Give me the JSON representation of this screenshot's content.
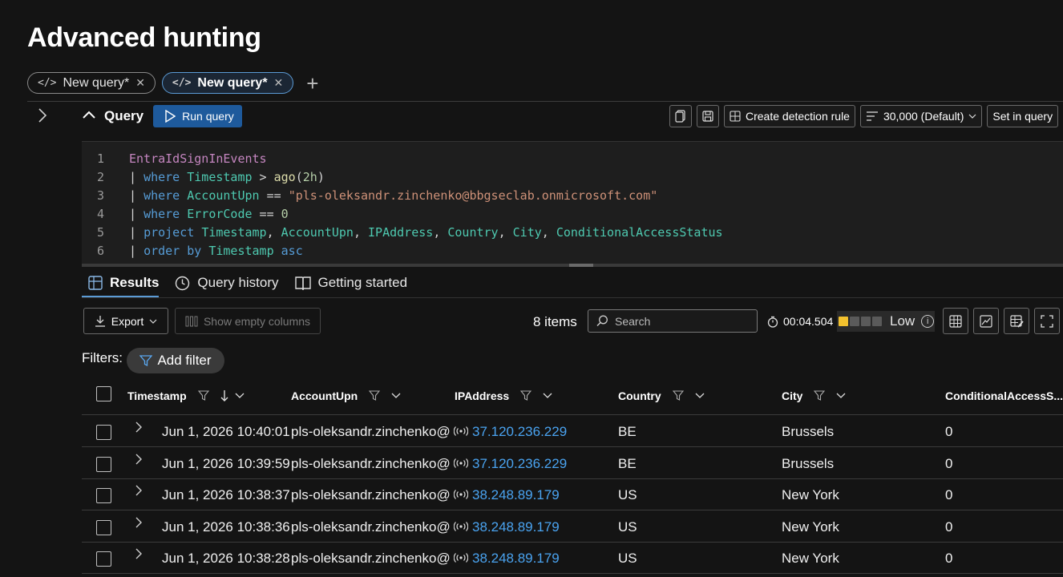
{
  "page": {
    "title": "Advanced hunting"
  },
  "tabs": [
    {
      "label": "New query*",
      "active": false
    },
    {
      "label": "New query*",
      "active": true
    }
  ],
  "query": {
    "header": "Query",
    "run_label": "Run query",
    "create_detection_label": "Create detection rule",
    "limit_label": "30,000 (Default)",
    "set_in_query_label": "Set in query",
    "lines": [
      {
        "n": "1",
        "tokens": [
          {
            "t": "EntraIdSignInEvents",
            "c": "tbl"
          }
        ]
      },
      {
        "n": "2",
        "tokens": [
          {
            "t": "| ",
            "c": "op"
          },
          {
            "t": "where",
            "c": "kw"
          },
          {
            "t": " ",
            "c": "op"
          },
          {
            "t": "Timestamp",
            "c": "col"
          },
          {
            "t": " > ",
            "c": "op"
          },
          {
            "t": "ago",
            "c": "fn"
          },
          {
            "t": "(",
            "c": "op"
          },
          {
            "t": "2h",
            "c": "num"
          },
          {
            "t": ")",
            "c": "op"
          }
        ]
      },
      {
        "n": "3",
        "tokens": [
          {
            "t": "| ",
            "c": "op"
          },
          {
            "t": "where",
            "c": "kw"
          },
          {
            "t": " ",
            "c": "op"
          },
          {
            "t": "AccountUpn",
            "c": "col"
          },
          {
            "t": " == ",
            "c": "op"
          },
          {
            "t": "\"pls-oleksandr.zinchenko@bbgseclab.onmicrosoft.com\"",
            "c": "str"
          }
        ]
      },
      {
        "n": "4",
        "tokens": [
          {
            "t": "| ",
            "c": "op"
          },
          {
            "t": "where",
            "c": "kw"
          },
          {
            "t": " ",
            "c": "op"
          },
          {
            "t": "ErrorCode",
            "c": "col"
          },
          {
            "t": " == ",
            "c": "op"
          },
          {
            "t": "0",
            "c": "num"
          }
        ]
      },
      {
        "n": "5",
        "tokens": [
          {
            "t": "| ",
            "c": "op"
          },
          {
            "t": "project",
            "c": "kw"
          },
          {
            "t": " ",
            "c": "op"
          },
          {
            "t": "Timestamp",
            "c": "col"
          },
          {
            "t": ", ",
            "c": "op"
          },
          {
            "t": "AccountUpn",
            "c": "col"
          },
          {
            "t": ", ",
            "c": "op"
          },
          {
            "t": "IPAddress",
            "c": "col"
          },
          {
            "t": ", ",
            "c": "op"
          },
          {
            "t": "Country",
            "c": "col"
          },
          {
            "t": ", ",
            "c": "op"
          },
          {
            "t": "City",
            "c": "col"
          },
          {
            "t": ", ",
            "c": "op"
          },
          {
            "t": "ConditionalAccessStatus",
            "c": "col"
          }
        ]
      },
      {
        "n": "6",
        "tokens": [
          {
            "t": "| ",
            "c": "op"
          },
          {
            "t": "order",
            "c": "kw"
          },
          {
            "t": " ",
            "c": "op"
          },
          {
            "t": "by",
            "c": "kw"
          },
          {
            "t": " ",
            "c": "op"
          },
          {
            "t": "Timestamp",
            "c": "col"
          },
          {
            "t": " ",
            "c": "op"
          },
          {
            "t": "asc",
            "c": "kw"
          }
        ]
      }
    ]
  },
  "results_tabs": [
    {
      "label": "Results",
      "icon": "table-icon",
      "active": true
    },
    {
      "label": "Query history",
      "icon": "clock-icon",
      "active": false
    },
    {
      "label": "Getting started",
      "icon": "book-icon",
      "active": false
    }
  ],
  "results_toolbar": {
    "export_label": "Export",
    "show_empty_label": "Show empty columns",
    "items_count": "8 items",
    "search_placeholder": "Search",
    "duration": "00:04.504",
    "usage_level": "Low",
    "usage_filled": 1,
    "usage_total": 4
  },
  "filters": {
    "label": "Filters:",
    "add_label": "Add filter"
  },
  "table": {
    "columns": [
      "Timestamp",
      "AccountUpn",
      "IPAddress",
      "Country",
      "City",
      "ConditionalAccessS..."
    ],
    "rows": [
      {
        "timestamp": "Jun 1, 2026 10:40:01",
        "account": "pls-oleksandr.zinchenko@",
        "ip": "37.120.236.229",
        "country": "BE",
        "city": "Brussels",
        "cas": "0"
      },
      {
        "timestamp": "Jun 1, 2026 10:39:59",
        "account": "pls-oleksandr.zinchenko@",
        "ip": "37.120.236.229",
        "country": "BE",
        "city": "Brussels",
        "cas": "0"
      },
      {
        "timestamp": "Jun 1, 2026 10:38:37",
        "account": "pls-oleksandr.zinchenko@",
        "ip": "38.248.89.179",
        "country": "US",
        "city": "New York",
        "cas": "0"
      },
      {
        "timestamp": "Jun 1, 2026 10:38:36",
        "account": "pls-oleksandr.zinchenko@",
        "ip": "38.248.89.179",
        "country": "US",
        "city": "New York",
        "cas": "0"
      },
      {
        "timestamp": "Jun 1, 2026 10:38:28",
        "account": "pls-oleksandr.zinchenko@",
        "ip": "38.248.89.179",
        "country": "US",
        "city": "New York",
        "cas": "0"
      }
    ]
  },
  "colors": {
    "accent": "#1e5a9c",
    "link": "#4aa3f0",
    "usage_on": "#f2c12e"
  }
}
